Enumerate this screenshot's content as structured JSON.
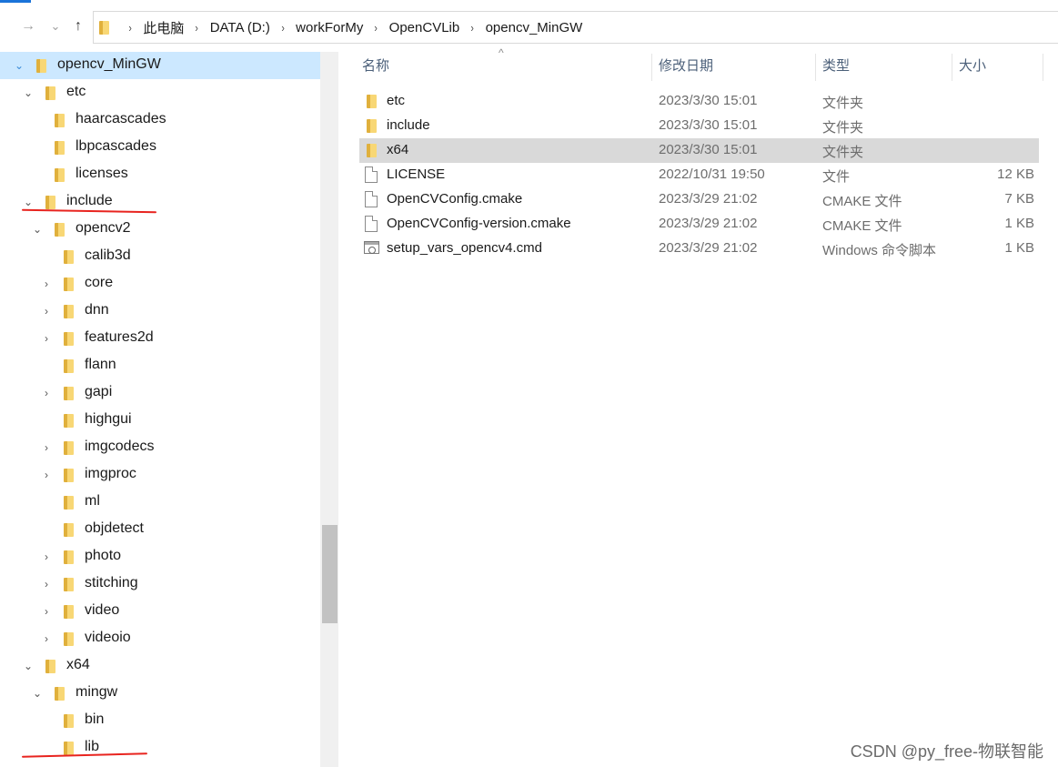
{
  "nav": {
    "back": "→",
    "forward": "⌄",
    "up": "↑"
  },
  "address": {
    "crumbs": [
      "此电脑",
      "DATA (D:)",
      "workForMy",
      "OpenCVLib",
      "opencv_MinGW"
    ],
    "separator": "›"
  },
  "tree": [
    {
      "label": "opencv_MinGW",
      "chevron": "⌄",
      "selected": true
    },
    {
      "label": "etc",
      "chevron": "⌄"
    },
    {
      "label": "haarcascades",
      "chevron": ""
    },
    {
      "label": "lbpcascades",
      "chevron": ""
    },
    {
      "label": "licenses",
      "chevron": ""
    },
    {
      "label": "include",
      "chevron": "⌄"
    },
    {
      "label": "opencv2",
      "chevron": "⌄"
    },
    {
      "label": "calib3d",
      "chevron": ""
    },
    {
      "label": "core",
      "chevron": "›"
    },
    {
      "label": "dnn",
      "chevron": "›"
    },
    {
      "label": "features2d",
      "chevron": "›"
    },
    {
      "label": "flann",
      "chevron": ""
    },
    {
      "label": "gapi",
      "chevron": "›"
    },
    {
      "label": "highgui",
      "chevron": ""
    },
    {
      "label": "imgcodecs",
      "chevron": "›"
    },
    {
      "label": "imgproc",
      "chevron": "›"
    },
    {
      "label": "ml",
      "chevron": ""
    },
    {
      "label": "objdetect",
      "chevron": ""
    },
    {
      "label": "photo",
      "chevron": "›"
    },
    {
      "label": "stitching",
      "chevron": "›"
    },
    {
      "label": "video",
      "chevron": "›"
    },
    {
      "label": "videoio",
      "chevron": "›"
    },
    {
      "label": "x64",
      "chevron": "⌄"
    },
    {
      "label": "mingw",
      "chevron": "⌄"
    },
    {
      "label": "bin",
      "chevron": ""
    },
    {
      "label": "lib",
      "chevron": ""
    }
  ],
  "columns": {
    "name": "名称",
    "modified": "修改日期",
    "type": "类型",
    "size": "大小",
    "sort_indicator": "^"
  },
  "files": [
    {
      "name": "etc",
      "modified": "2023/3/30 15:01",
      "type": "文件夹",
      "size": "",
      "icon": "folder-icon"
    },
    {
      "name": "include",
      "modified": "2023/3/30 15:01",
      "type": "文件夹",
      "size": "",
      "icon": "folder-icon"
    },
    {
      "name": "x64",
      "modified": "2023/3/30 15:01",
      "type": "文件夹",
      "size": "",
      "icon": "folder-icon",
      "highlighted": true
    },
    {
      "name": "LICENSE",
      "modified": "2022/10/31 19:50",
      "type": "文件",
      "size": "12 KB",
      "icon": "file-icon"
    },
    {
      "name": "OpenCVConfig.cmake",
      "modified": "2023/3/29 21:02",
      "type": "CMAKE 文件",
      "size": "7 KB",
      "icon": "file-icon"
    },
    {
      "name": "OpenCVConfig-version.cmake",
      "modified": "2023/3/29 21:02",
      "type": "CMAKE 文件",
      "size": "1 KB",
      "icon": "file-icon"
    },
    {
      "name": "setup_vars_opencv4.cmd",
      "modified": "2023/3/29 21:02",
      "type": "Windows 命令脚本",
      "size": "1 KB",
      "icon": "cmd-script-icon"
    }
  ],
  "watermark": "CSDN @py_free-物联智能",
  "colors": {
    "selection": "#cce8ff",
    "highlight_row": "#d9d9d9",
    "annotation_red": "#e8241f",
    "folder": "#f8d775"
  }
}
